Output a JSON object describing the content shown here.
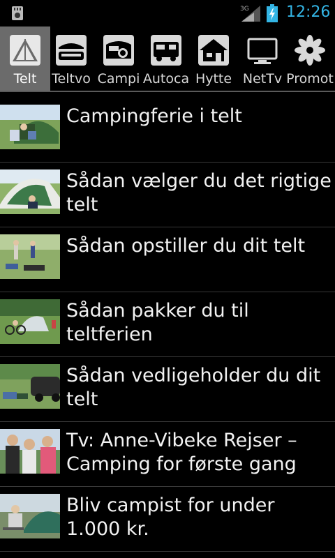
{
  "status": {
    "network": "3G",
    "time": "12:26"
  },
  "tabs": [
    {
      "label": "Telt",
      "icon": "tent-icon",
      "active": true
    },
    {
      "label": "Teltvo",
      "icon": "tent-trailer-icon",
      "active": false
    },
    {
      "label": "Campi",
      "icon": "caravan-icon",
      "active": false
    },
    {
      "label": "Autoca",
      "icon": "motorhome-icon",
      "active": false
    },
    {
      "label": "Hytte",
      "icon": "cabin-icon",
      "active": false
    },
    {
      "label": "NetTv",
      "icon": "tv-icon",
      "active": false
    },
    {
      "label": "Promot",
      "icon": "flower-icon",
      "active": false
    }
  ],
  "articles": [
    {
      "title": "Campingferie i telt"
    },
    {
      "title": "Sådan vælger du det rigtige telt"
    },
    {
      "title": "Sådan opstiller du dit telt"
    },
    {
      "title": "Sådan pakker du til teltferien"
    },
    {
      "title": "Sådan vedligeholder du dit telt"
    },
    {
      "title": "Tv: Anne-Vibeke Rejser – Camping for første gang"
    },
    {
      "title": "Bliv campist for under 1.000 kr."
    }
  ]
}
